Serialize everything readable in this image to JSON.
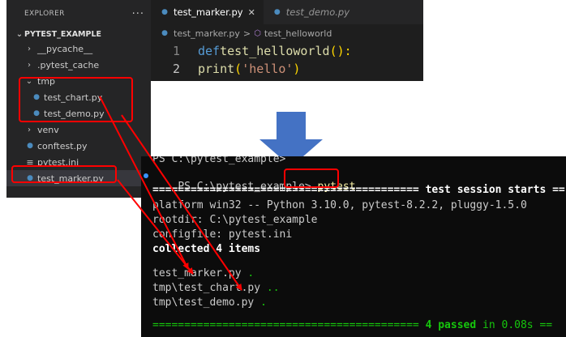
{
  "explorer": {
    "title": "EXPLORER",
    "more": "···",
    "root": "PYTEST_EXAMPLE",
    "items": [
      {
        "chev": "›",
        "icon": "",
        "label": "__pycache__"
      },
      {
        "chev": "›",
        "icon": "",
        "label": ".pytest_cache"
      },
      {
        "chev": "⌄",
        "icon": "",
        "label": "tmp"
      },
      {
        "chev": "",
        "icon": "python-file-icon",
        "label": "test_chart.py"
      },
      {
        "chev": "",
        "icon": "python-file-icon",
        "label": "test_demo.py"
      },
      {
        "chev": "›",
        "icon": "",
        "label": "venv"
      },
      {
        "chev": "",
        "icon": "python-file-icon",
        "label": "conftest.py"
      },
      {
        "chev": "",
        "icon": "settings-file-icon",
        "label": "pytest.ini"
      },
      {
        "chev": "",
        "icon": "python-file-icon",
        "label": "test_marker.py"
      }
    ]
  },
  "editor": {
    "tabs": [
      {
        "label": "test_marker.py",
        "close": "✕"
      },
      {
        "label": "test_demo.py"
      }
    ],
    "breadcrumb": {
      "file": "test_marker.py",
      "sep": ">",
      "symbol": "test_helloworld"
    },
    "lines": [
      {
        "num": "1",
        "kw": "def",
        "fn": "test_helloworld",
        "paren": "():"
      },
      {
        "num": "2",
        "fn": "print",
        "open": "(",
        "str": "'hello'",
        "close": ")"
      }
    ]
  },
  "terminal": {
    "clipped_line": "PS C:\\pytest_example>",
    "prompt": "PS C:\\pytest_example>",
    "command": "pytest",
    "session_sep": "==========================================",
    "session_title": "test session starts",
    "session_tail": "==",
    "platform": "platform win32 -- Python 3.10.0, pytest-8.2.2, pluggy-1.5.0",
    "rootdir": "rootdir: C:\\pytest_example",
    "configfile": "configfile: pytest.ini",
    "collected": "collected 4 items",
    "results": [
      {
        "file": "test_marker.py",
        "dots": "."
      },
      {
        "file": "tmp\\test_chart.py",
        "dots": ".."
      },
      {
        "file": "tmp\\test_demo.py",
        "dots": "."
      }
    ],
    "summary_sep": "==========================================",
    "summary_passed": "4 passed",
    "summary_time": "in 0.08s",
    "summary_tail": "=="
  },
  "colors": {
    "highlight": "#ff0000",
    "arrow": "#4472c4",
    "terminal_bg": "#0c0c0c",
    "explorer_bg": "#252526",
    "editor_bg": "#1e1e1e"
  }
}
